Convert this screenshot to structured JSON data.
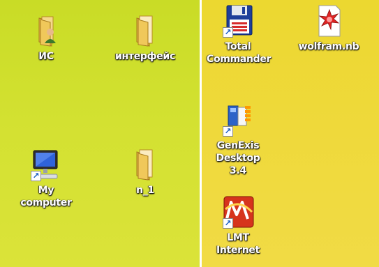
{
  "desktop_left": {
    "icons": [
      {
        "label": "ИС",
        "icon": "user-folder-icon"
      },
      {
        "label": "интерфейс",
        "icon": "folder-icon"
      },
      {
        "label": "My computer",
        "icon": "computer-icon"
      },
      {
        "label": "n_1",
        "icon": "folder-icon"
      }
    ]
  },
  "desktop_right": {
    "icons": [
      {
        "label": "Total Commander",
        "icon": "floppy-disk-icon"
      },
      {
        "label": "wolfram.nb",
        "icon": "mathematica-notebook-icon"
      },
      {
        "label": "GenExis Desktop 3.4",
        "icon": "genexis-icon"
      },
      {
        "label": "LMT Internet",
        "icon": "lmt-icon"
      }
    ]
  },
  "colors": {
    "left_background": "#d3e131",
    "right_background": "#efd93b",
    "label_text": "#ffffff"
  }
}
